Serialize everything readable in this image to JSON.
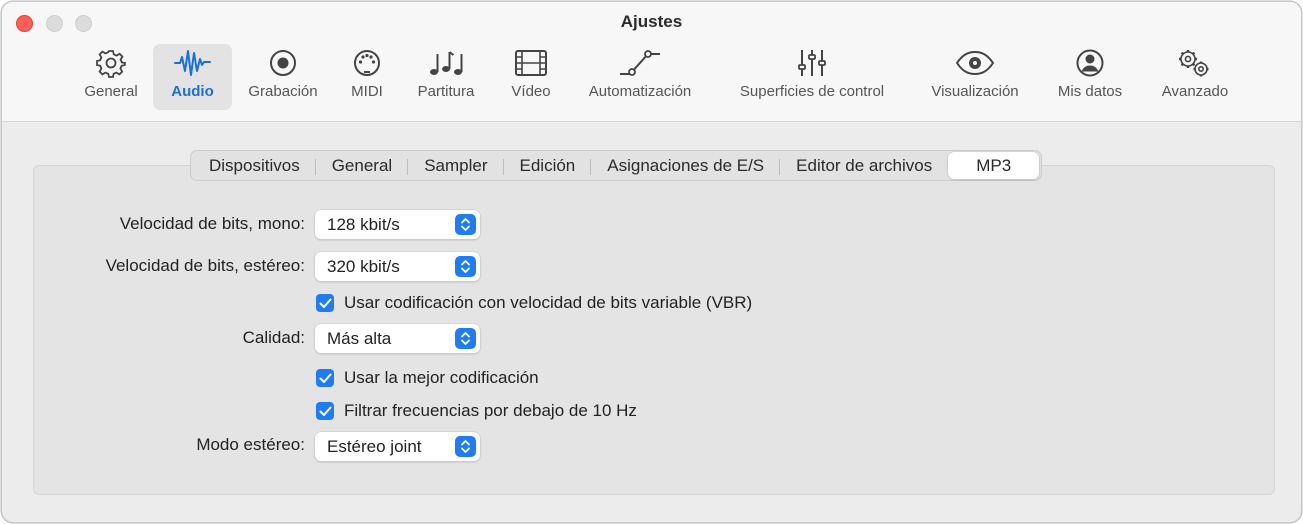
{
  "window": {
    "title": "Ajustes",
    "accent_color": "#1f7cf5",
    "close_color": "#fe5f57"
  },
  "toolbar": {
    "items": [
      {
        "label": "General",
        "icon": "gear-icon"
      },
      {
        "label": "Audio",
        "icon": "waveform-icon",
        "active": true
      },
      {
        "label": "Grabación",
        "icon": "record-icon"
      },
      {
        "label": "MIDI",
        "icon": "midi-port-icon"
      },
      {
        "label": "Partitura",
        "icon": "music-notes-icon"
      },
      {
        "label": "Vídeo",
        "icon": "film-icon"
      },
      {
        "label": "Automatización",
        "icon": "automation-curve-icon"
      },
      {
        "label": "Superficies de control",
        "icon": "faders-icon"
      },
      {
        "label": "Visualización",
        "icon": "eye-icon"
      },
      {
        "label": "Mis datos",
        "icon": "person-icon"
      },
      {
        "label": "Avanzado",
        "icon": "gears-icon"
      }
    ]
  },
  "tabs": {
    "items": [
      "Dispositivos",
      "General",
      "Sampler",
      "Edición",
      "Asignaciones de E/S",
      "Editor de archivos",
      "MP3"
    ],
    "selected": "MP3"
  },
  "form": {
    "bitrate_mono": {
      "label": "Velocidad de bits, mono:",
      "value": "128 kbit/s"
    },
    "bitrate_stereo": {
      "label": "Velocidad de bits, estéreo:",
      "value": "320 kbit/s"
    },
    "vbr": {
      "label": "Usar codificación con velocidad de bits variable (VBR)",
      "checked": true
    },
    "quality": {
      "label": "Calidad:",
      "value": "Más alta"
    },
    "best_encoding": {
      "label": "Usar la mejor codificación",
      "checked": true
    },
    "filter": {
      "label": "Filtrar frecuencias por debajo de 10 Hz",
      "checked": true
    },
    "stereo_mode": {
      "label": "Modo estéreo:",
      "value": "Estéreo joint"
    }
  }
}
